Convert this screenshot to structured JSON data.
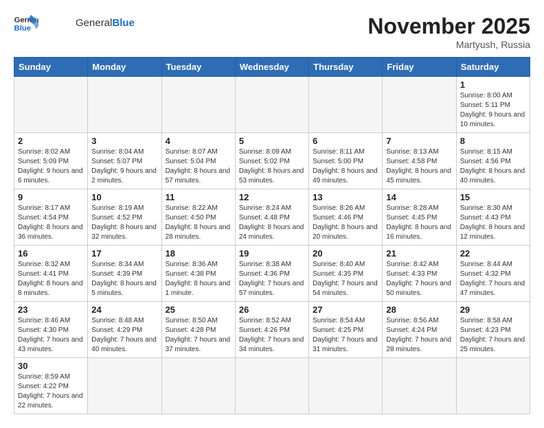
{
  "header": {
    "logo_general": "General",
    "logo_blue": "Blue",
    "month_title": "November 2025",
    "location": "Martyush, Russia"
  },
  "weekdays": [
    "Sunday",
    "Monday",
    "Tuesday",
    "Wednesday",
    "Thursday",
    "Friday",
    "Saturday"
  ],
  "weeks": [
    [
      {
        "day": "",
        "info": ""
      },
      {
        "day": "",
        "info": ""
      },
      {
        "day": "",
        "info": ""
      },
      {
        "day": "",
        "info": ""
      },
      {
        "day": "",
        "info": ""
      },
      {
        "day": "",
        "info": ""
      },
      {
        "day": "1",
        "info": "Sunrise: 8:00 AM\nSunset: 5:11 PM\nDaylight: 9 hours and 10 minutes."
      }
    ],
    [
      {
        "day": "2",
        "info": "Sunrise: 8:02 AM\nSunset: 5:09 PM\nDaylight: 9 hours and 6 minutes."
      },
      {
        "day": "3",
        "info": "Sunrise: 8:04 AM\nSunset: 5:07 PM\nDaylight: 9 hours and 2 minutes."
      },
      {
        "day": "4",
        "info": "Sunrise: 8:07 AM\nSunset: 5:04 PM\nDaylight: 8 hours and 57 minutes."
      },
      {
        "day": "5",
        "info": "Sunrise: 8:09 AM\nSunset: 5:02 PM\nDaylight: 8 hours and 53 minutes."
      },
      {
        "day": "6",
        "info": "Sunrise: 8:11 AM\nSunset: 5:00 PM\nDaylight: 8 hours and 49 minutes."
      },
      {
        "day": "7",
        "info": "Sunrise: 8:13 AM\nSunset: 4:58 PM\nDaylight: 8 hours and 45 minutes."
      },
      {
        "day": "8",
        "info": "Sunrise: 8:15 AM\nSunset: 4:56 PM\nDaylight: 8 hours and 40 minutes."
      }
    ],
    [
      {
        "day": "9",
        "info": "Sunrise: 8:17 AM\nSunset: 4:54 PM\nDaylight: 8 hours and 36 minutes."
      },
      {
        "day": "10",
        "info": "Sunrise: 8:19 AM\nSunset: 4:52 PM\nDaylight: 8 hours and 32 minutes."
      },
      {
        "day": "11",
        "info": "Sunrise: 8:22 AM\nSunset: 4:50 PM\nDaylight: 8 hours and 28 minutes."
      },
      {
        "day": "12",
        "info": "Sunrise: 8:24 AM\nSunset: 4:48 PM\nDaylight: 8 hours and 24 minutes."
      },
      {
        "day": "13",
        "info": "Sunrise: 8:26 AM\nSunset: 4:46 PM\nDaylight: 8 hours and 20 minutes."
      },
      {
        "day": "14",
        "info": "Sunrise: 8:28 AM\nSunset: 4:45 PM\nDaylight: 8 hours and 16 minutes."
      },
      {
        "day": "15",
        "info": "Sunrise: 8:30 AM\nSunset: 4:43 PM\nDaylight: 8 hours and 12 minutes."
      }
    ],
    [
      {
        "day": "16",
        "info": "Sunrise: 8:32 AM\nSunset: 4:41 PM\nDaylight: 8 hours and 8 minutes."
      },
      {
        "day": "17",
        "info": "Sunrise: 8:34 AM\nSunset: 4:39 PM\nDaylight: 8 hours and 5 minutes."
      },
      {
        "day": "18",
        "info": "Sunrise: 8:36 AM\nSunset: 4:38 PM\nDaylight: 8 hours and 1 minute."
      },
      {
        "day": "19",
        "info": "Sunrise: 8:38 AM\nSunset: 4:36 PM\nDaylight: 7 hours and 57 minutes."
      },
      {
        "day": "20",
        "info": "Sunrise: 8:40 AM\nSunset: 4:35 PM\nDaylight: 7 hours and 54 minutes."
      },
      {
        "day": "21",
        "info": "Sunrise: 8:42 AM\nSunset: 4:33 PM\nDaylight: 7 hours and 50 minutes."
      },
      {
        "day": "22",
        "info": "Sunrise: 8:44 AM\nSunset: 4:32 PM\nDaylight: 7 hours and 47 minutes."
      }
    ],
    [
      {
        "day": "23",
        "info": "Sunrise: 8:46 AM\nSunset: 4:30 PM\nDaylight: 7 hours and 43 minutes."
      },
      {
        "day": "24",
        "info": "Sunrise: 8:48 AM\nSunset: 4:29 PM\nDaylight: 7 hours and 40 minutes."
      },
      {
        "day": "25",
        "info": "Sunrise: 8:50 AM\nSunset: 4:28 PM\nDaylight: 7 hours and 37 minutes."
      },
      {
        "day": "26",
        "info": "Sunrise: 8:52 AM\nSunset: 4:26 PM\nDaylight: 7 hours and 34 minutes."
      },
      {
        "day": "27",
        "info": "Sunrise: 8:54 AM\nSunset: 4:25 PM\nDaylight: 7 hours and 31 minutes."
      },
      {
        "day": "28",
        "info": "Sunrise: 8:56 AM\nSunset: 4:24 PM\nDaylight: 7 hours and 28 minutes."
      },
      {
        "day": "29",
        "info": "Sunrise: 8:58 AM\nSunset: 4:23 PM\nDaylight: 7 hours and 25 minutes."
      }
    ],
    [
      {
        "day": "30",
        "info": "Sunrise: 8:59 AM\nSunset: 4:22 PM\nDaylight: 7 hours and 22 minutes."
      },
      {
        "day": "",
        "info": ""
      },
      {
        "day": "",
        "info": ""
      },
      {
        "day": "",
        "info": ""
      },
      {
        "day": "",
        "info": ""
      },
      {
        "day": "",
        "info": ""
      },
      {
        "day": "",
        "info": ""
      }
    ]
  ]
}
